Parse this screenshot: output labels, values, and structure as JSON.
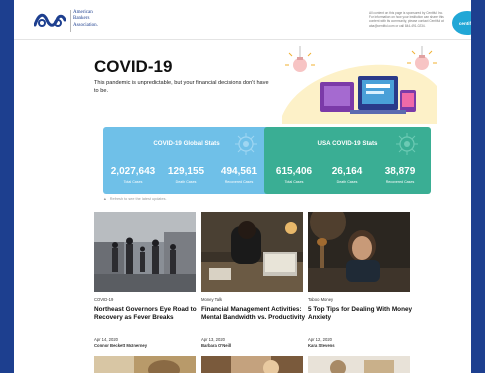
{
  "brand": {
    "logo_lines": [
      "American",
      "Bankers",
      "Association."
    ],
    "sponsor_lines": [
      "All content on this page is sponsored by Centiful Inc.",
      "For information on how your institution can share this",
      "content with its community, please contact Centiful at",
      "aba@centiful.com or call 844-491-0234."
    ],
    "sponsor_link_text": "information",
    "badge_label": "centiful"
  },
  "hero": {
    "title": "COVID-19",
    "subtitle": "This pandemic is unpredictable, but your financial decisions don't have to be."
  },
  "global_stats": {
    "title": "COVID-19 Global Stats",
    "color": "#6fc0e8",
    "stats": [
      {
        "value": "2,027,643",
        "label": "Total Cases"
      },
      {
        "value": "129,155",
        "label": "Death Cases"
      },
      {
        "value": "494,561",
        "label": "Recovered Cases"
      }
    ]
  },
  "usa_stats": {
    "title": "USA COVID-19 Stats",
    "color": "#3aae94",
    "stats": [
      {
        "value": "615,406",
        "label": "Total Cases"
      },
      {
        "value": "26,164",
        "label": "Death Cases"
      },
      {
        "value": "38,879",
        "label": "Recovered Cases"
      }
    ]
  },
  "refresh_text": "Refresh to see the latest updates.",
  "articles": [
    {
      "category": "COVID-19",
      "headline": "Northeast Governors Eye Road to Recovery as Fever Breaks",
      "date": "Apr 14, 2020",
      "author": "Connor Beckett McInerney"
    },
    {
      "category": "Money Talk",
      "headline": "Financial Management Activities: Mental Bandwidth vs. Productivity",
      "date": "Apr 13, 2020",
      "author": "Barbara O'Neill"
    },
    {
      "category": "Taboo Money",
      "headline": "5 Top Tips for Dealing With Money Anxiety",
      "date": "Apr 12, 2020",
      "author": "Kara Stevens"
    }
  ],
  "colors": {
    "page_background": "#1d3f8f",
    "brand_navy": "#1d3f8f",
    "global_card": "#6fc0e8",
    "usa_card": "#3aae94"
  }
}
